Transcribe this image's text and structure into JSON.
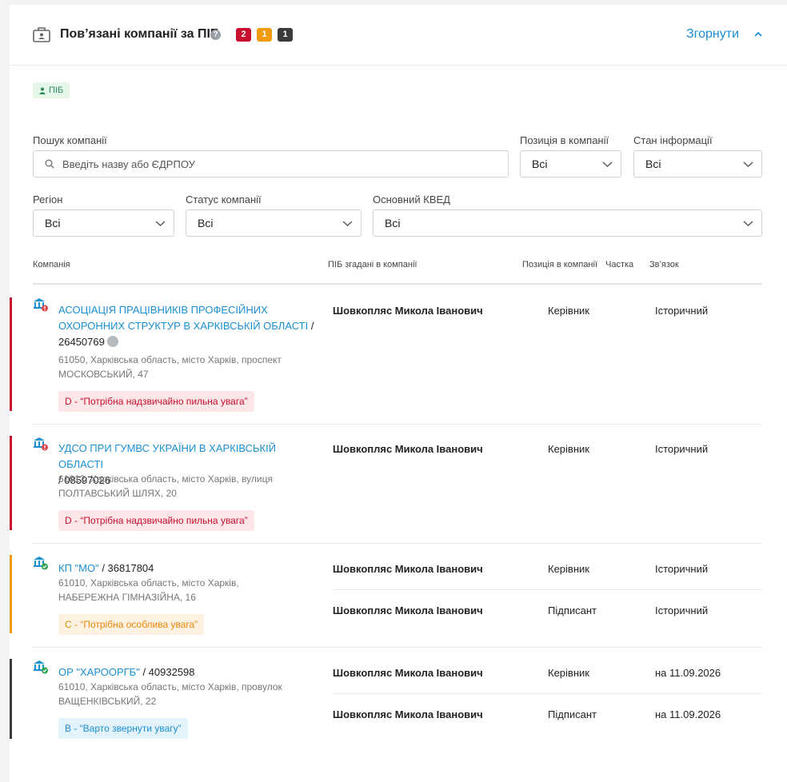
{
  "header": {
    "title": "Пов’язані компанії за ПІБ",
    "help": "?",
    "badges": [
      {
        "count": "2",
        "color": "#c8102e"
      },
      {
        "count": "1",
        "color": "#f29a0d"
      },
      {
        "count": "1",
        "color": "#3a3a3a"
      }
    ],
    "collapse_label": "Згорнути"
  },
  "tag": {
    "label": "ПІБ"
  },
  "filters": {
    "search_label": "Пошук компанії",
    "search_placeholder": "Введіть назву або ЄДРПОУ",
    "position_label": "Позиція в компанії",
    "position_value": "Всі",
    "info_state_label": "Стан інформації",
    "info_state_value": "Всі",
    "region_label": "Регіон",
    "region_value": "Всі",
    "status_label": "Статус компанії",
    "status_value": "Всі",
    "kved_label": "Основний КВЕД",
    "kved_value": "Всі"
  },
  "table": {
    "headers": {
      "company": "Компанія",
      "pib": "ПІБ згадані в компанії",
      "position": "Позиція в компанії",
      "share": "Частка",
      "relation": "Зв’язок"
    },
    "rows": [
      {
        "name_line1": "АСОЦІАЦІЯ ПРАЦІВНИКІВ ПРОФЕСІЙНИХ",
        "name_line2": "ОХОРОННИХ СТРУКТУР В ХАРКІВСЬКІЙ ОБЛАСТІ",
        "slash": " /",
        "code": "26450769",
        "address_line1": "61050, Харківська область, місто Харків, проспект",
        "address_line2": "МОСКОВСЬКИЙ, 47",
        "risk": "D - “Потрібна надзвичайно пильна увага”",
        "bar_color": "#c8102e",
        "persons": [
          {
            "pib": "Шовкопляс Микола Іванович",
            "position": "Керівник",
            "relation": "Історичний"
          }
        ]
      },
      {
        "name_line1": "УДСО ПРИ ГУМВС УКРАЇНИ В ХАРКІВСЬКІЙ ОБЛАСТІ",
        "slash": "/ ",
        "code": "08597026",
        "address_line1": "61012, Харківська область, місто Харків, вулиця",
        "address_line2": "ПОЛТАВСЬКИЙ ШЛЯХ, 20",
        "risk": "D - “Потрібна надзвичайно пильна увага”",
        "bar_color": "#c8102e",
        "persons": [
          {
            "pib": "Шовкопляс Микола Іванович",
            "position": "Керівник",
            "relation": "Історичний"
          }
        ]
      },
      {
        "name_line1": "КП \"МО\"",
        "slash": " / ",
        "code": "36817804",
        "address_line1": "61010, Харківська область, місто Харків,",
        "address_line2": "НАБЕРЕЖНА ГІМНАЗІЙНА, 16",
        "risk": "C - “Потрібна особлива увага”",
        "bar_color": "#f29a0d",
        "persons": [
          {
            "pib": "Шовкопляс Микола Іванович",
            "position": "Керівник",
            "relation": "Історичний"
          },
          {
            "pib": "Шовкопляс Микола Іванович",
            "position": "Підписант",
            "relation": "Історичний"
          }
        ]
      },
      {
        "name_line1": "ОР \"ХАРООРГБ\"",
        "slash": " / ",
        "code": "40932598",
        "address_line1": "61010, Харківська область, місто Харків, провулок",
        "address_line2": "ВАЩЕНКІВСЬКИЙ, 22",
        "risk": "B - “Варто звернути увагу”",
        "bar_color": "#3a3a3a",
        "persons": [
          {
            "pib": "Шовкопляс Микола Іванович",
            "position": "Керівник",
            "relation": "на 11.09.2026"
          },
          {
            "pib": "Шовкопляс Микола Іванович",
            "position": "Підписант",
            "relation": "на 11.09.2026"
          }
        ]
      }
    ]
  }
}
